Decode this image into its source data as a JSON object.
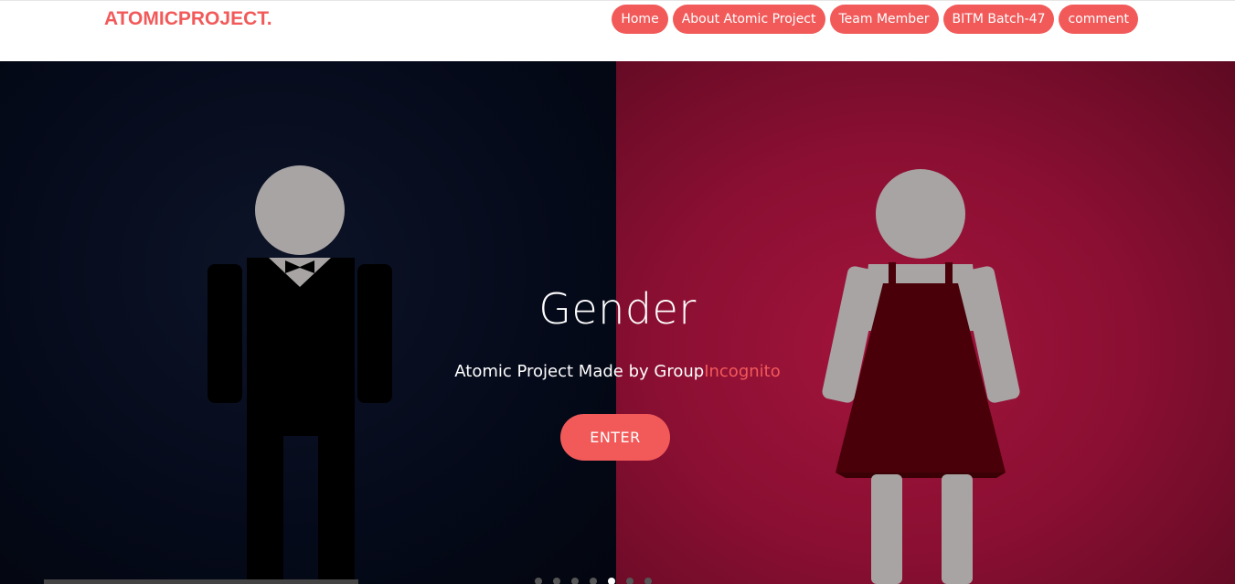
{
  "brand": {
    "logo_text": "ATOMICPROJECT."
  },
  "nav": {
    "items": [
      {
        "label": "Home"
      },
      {
        "label": "About Atomic Project"
      },
      {
        "label": "Team Member"
      },
      {
        "label": "BITM Batch-47"
      },
      {
        "label": "comment"
      }
    ]
  },
  "hero": {
    "title": "Gender",
    "subtitle_prefix": "Atomic Project Made by Group",
    "subtitle_accent": "Incognito",
    "enter_label": "ENTER",
    "slide_count": 7,
    "active_slide": 5
  },
  "colors": {
    "accent": "#f25a5a",
    "left_panel": "#050a1a",
    "right_panel": "#8a0f32",
    "figure_gray": "#a8a4a4",
    "dress": "#4a0008"
  },
  "icons": {
    "male_figure": "man-figure-icon",
    "female_figure": "woman-figure-icon"
  }
}
